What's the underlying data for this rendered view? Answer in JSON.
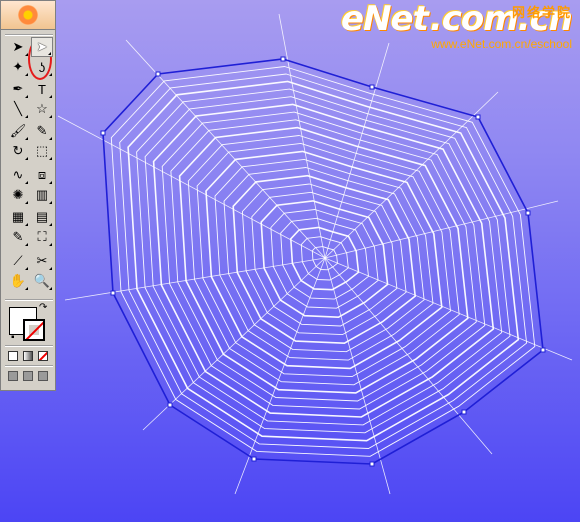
{
  "watermark": {
    "logo": "eNet",
    "domain": ".com.cn",
    "chinese": "网络学院",
    "url": "www.eNet.com.cn/eschool"
  },
  "toolbox": {
    "tools": [
      {
        "name": "selection-tool",
        "glyph": "➤",
        "icon": "selection-arrow-icon"
      },
      {
        "name": "direct-selection-tool",
        "glyph": "➤",
        "icon": "direct-selection-icon"
      },
      {
        "name": "magic-wand-tool",
        "glyph": "✦",
        "icon": "magic-wand-icon"
      },
      {
        "name": "lasso-tool",
        "glyph": "ʖ",
        "icon": "lasso-icon"
      },
      {
        "name": "pen-tool",
        "glyph": "✒",
        "icon": "pen-icon"
      },
      {
        "name": "type-tool",
        "glyph": "T",
        "icon": "type-icon"
      },
      {
        "name": "line-tool",
        "glyph": "╲",
        "icon": "line-segment-icon"
      },
      {
        "name": "star-tool",
        "glyph": "☆",
        "icon": "star-icon"
      },
      {
        "name": "paintbrush-tool",
        "glyph": "🖌",
        "icon": "paintbrush-icon"
      },
      {
        "name": "pencil-tool",
        "glyph": "✎",
        "icon": "pencil-icon"
      },
      {
        "name": "rotate-tool",
        "glyph": "↻",
        "icon": "rotate-icon"
      },
      {
        "name": "scale-tool",
        "glyph": "⬚",
        "icon": "scale-icon"
      },
      {
        "name": "warp-tool",
        "glyph": "∿",
        "icon": "warp-icon"
      },
      {
        "name": "free-transform-tool",
        "glyph": "⧈",
        "icon": "free-transform-icon"
      },
      {
        "name": "symbol-sprayer-tool",
        "glyph": "✺",
        "icon": "symbol-sprayer-icon"
      },
      {
        "name": "graph-tool",
        "glyph": "▥",
        "icon": "column-graph-icon"
      },
      {
        "name": "mesh-tool",
        "glyph": "▦",
        "icon": "mesh-icon"
      },
      {
        "name": "gradient-tool",
        "glyph": "▤",
        "icon": "gradient-icon"
      },
      {
        "name": "eyedropper-tool",
        "glyph": "✎",
        "icon": "eyedropper-icon"
      },
      {
        "name": "live-paint-tool",
        "glyph": "⛶",
        "icon": "live-paint-bucket-icon"
      },
      {
        "name": "slice-tool",
        "glyph": "⟋",
        "icon": "slice-icon"
      },
      {
        "name": "scissors-tool",
        "glyph": "✂",
        "icon": "scissors-icon"
      },
      {
        "name": "hand-tool",
        "glyph": "✋",
        "icon": "hand-icon"
      },
      {
        "name": "zoom-tool",
        "glyph": "🔍",
        "icon": "zoom-icon"
      }
    ]
  },
  "colors": {
    "fill": "#ffffff",
    "stroke": "#ffffff",
    "none_slash": "#e00000",
    "path_selection": "#1f1fd6",
    "background_top": "#a89cf0",
    "background_bottom": "#4c45f4",
    "highlight_ring": "#e41b1b"
  }
}
